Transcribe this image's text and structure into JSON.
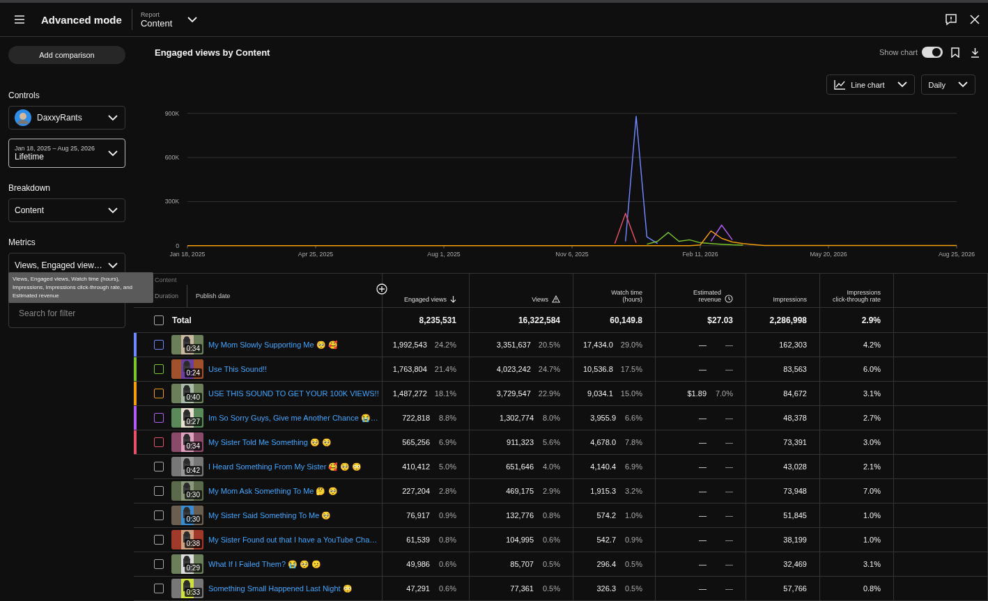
{
  "topbar": {
    "title": "Advanced mode",
    "report_label": "Report",
    "report_value": "Content"
  },
  "sidebar": {
    "add_comparison": "Add comparison",
    "controls_label": "Controls",
    "channel": "DaxxyRants",
    "date_range": "Jan 18, 2025 – Aug 25, 2026",
    "period": "Lifetime",
    "breakdown_label": "Breakdown",
    "breakdown": "Content",
    "metrics_label": "Metrics",
    "metrics": "Views, Engaged view…",
    "tooltip": "Views, Engaged views, Watch time (hours), Impressions, Impressions click-through rate, and Estimated revenue",
    "filter_placeholder": "Search for filter"
  },
  "chart_panel": {
    "title": "Engaged views by Content",
    "show_chart_label": "Show chart",
    "show_chart_on": true,
    "chart_type": "Line chart",
    "interval": "Daily",
    "chart_data": {
      "type": "line",
      "categories": [
        "Jan 18, 2025",
        null,
        null,
        null,
        null,
        null,
        null,
        null,
        null,
        null,
        null,
        null,
        "Apr 25, 2025",
        null,
        null,
        null,
        null,
        null,
        null,
        null,
        null,
        null,
        null,
        null,
        "Aug 1, 2025",
        null,
        null,
        null,
        null,
        null,
        null,
        null,
        null,
        null,
        null,
        null,
        "Nov 6, 2025",
        null,
        null,
        null,
        null,
        null,
        null,
        null,
        null,
        null,
        null,
        null,
        "Feb 11, 2026",
        null,
        null,
        null,
        null,
        null,
        null,
        null,
        null,
        null,
        null,
        null,
        "May 20, 2026",
        null,
        null,
        null,
        null,
        null,
        null,
        null,
        null,
        null,
        null,
        null,
        "Aug 25, 2026"
      ],
      "yticks": [
        {
          "value": 0,
          "label": "0"
        },
        {
          "value": 300000,
          "label": "300K"
        },
        {
          "value": 600000,
          "label": "600K"
        },
        {
          "value": 900000,
          "label": "900K"
        }
      ],
      "ylim": [
        0,
        900000
      ],
      "series": [
        {
          "color": "#6f87ff",
          "values": [
            null,
            null,
            null,
            null,
            null,
            null,
            null,
            null,
            null,
            null,
            null,
            null,
            null,
            null,
            null,
            null,
            null,
            null,
            null,
            null,
            null,
            null,
            null,
            null,
            null,
            null,
            null,
            null,
            null,
            null,
            null,
            null,
            null,
            null,
            null,
            null,
            null,
            null,
            null,
            null,
            null,
            30000,
            880000,
            60000,
            15000,
            null,
            null,
            null,
            null,
            null,
            null,
            null,
            null,
            null,
            null,
            null,
            null,
            null,
            null,
            null,
            null,
            null,
            null,
            null,
            null,
            null,
            null,
            null,
            null,
            null,
            null,
            null,
            null
          ]
        },
        {
          "color": "#7cc62c",
          "values": [
            null,
            null,
            null,
            null,
            null,
            null,
            null,
            null,
            null,
            null,
            null,
            null,
            null,
            null,
            null,
            null,
            null,
            null,
            null,
            null,
            null,
            null,
            null,
            null,
            null,
            null,
            null,
            null,
            null,
            null,
            null,
            null,
            null,
            null,
            null,
            null,
            null,
            null,
            null,
            null,
            null,
            null,
            null,
            10000,
            30000,
            90000,
            30000,
            40000,
            20000,
            15000,
            10000,
            6000,
            4000,
            null,
            null,
            null,
            null,
            null,
            null,
            null,
            null,
            null,
            null,
            null,
            null,
            null,
            null,
            null,
            null,
            null,
            null,
            null,
            null
          ]
        },
        {
          "color": "#b35cf5",
          "values": [
            null,
            null,
            null,
            null,
            null,
            null,
            null,
            null,
            null,
            null,
            null,
            null,
            null,
            null,
            null,
            null,
            null,
            null,
            null,
            null,
            null,
            null,
            null,
            null,
            null,
            null,
            null,
            null,
            null,
            null,
            null,
            null,
            null,
            null,
            null,
            null,
            null,
            null,
            null,
            null,
            null,
            null,
            null,
            null,
            null,
            null,
            null,
            null,
            null,
            30000,
            140000,
            40000,
            null,
            null,
            null,
            null,
            null,
            null,
            null,
            null,
            null,
            null,
            null,
            null,
            null,
            null,
            null,
            null,
            null,
            null,
            null,
            null,
            null
          ]
        },
        {
          "color": "#e9506a",
          "values": [
            null,
            null,
            null,
            null,
            null,
            null,
            null,
            null,
            null,
            null,
            null,
            null,
            null,
            null,
            null,
            null,
            null,
            null,
            null,
            null,
            null,
            null,
            null,
            null,
            null,
            null,
            null,
            null,
            null,
            null,
            null,
            null,
            null,
            null,
            null,
            null,
            null,
            null,
            null,
            null,
            15000,
            220000,
            20000,
            null,
            null,
            null,
            null,
            null,
            null,
            null,
            null,
            null,
            null,
            null,
            null,
            null,
            null,
            null,
            null,
            null,
            null,
            null,
            null,
            null,
            null,
            null,
            null,
            null,
            null,
            null,
            null,
            null,
            null
          ]
        },
        {
          "color": "#f59e0b",
          "values": [
            0,
            0,
            0,
            0,
            0,
            0,
            0,
            0,
            0,
            0,
            0,
            0,
            0,
            0,
            0,
            0,
            0,
            0,
            0,
            0,
            0,
            0,
            0,
            0,
            0,
            0,
            0,
            0,
            0,
            0,
            0,
            0,
            0,
            0,
            0,
            0,
            0,
            0,
            0,
            0,
            0,
            0,
            0,
            0,
            0,
            0,
            0,
            0,
            5000,
            100000,
            50000,
            25000,
            15000,
            8000,
            2000,
            2000,
            2000,
            2000,
            2000,
            2000,
            2000,
            2000,
            2000,
            2000,
            2000,
            2000,
            2000,
            2000,
            2000,
            2000,
            2000,
            2000,
            2000
          ]
        }
      ]
    }
  },
  "table": {
    "headers": {
      "content": "Content",
      "duration": "Duration",
      "publish_date": "Publish date"
    },
    "columns": [
      {
        "label": "Engaged views"
      },
      {
        "label": "Views"
      },
      {
        "label": "Watch time (hours)"
      },
      {
        "label": "Estimated revenue"
      },
      {
        "label": "Impressions"
      },
      {
        "label": "Impressions click-through rate"
      }
    ],
    "total": {
      "label": "Total",
      "checked": false,
      "values": [
        "8,235,531",
        "16,322,584",
        "60,149.8",
        "$27.03",
        "2,286,998",
        "2.9%"
      ]
    },
    "rows": [
      {
        "color": "#6f87ff",
        "checked": false,
        "duration": "0:34",
        "title": "My Mom Slowly Supporting Me 🥺 🥰",
        "cells": [
          {
            "value": "1,992,543",
            "pct": "24.2%"
          },
          {
            "value": "3,351,637",
            "pct": "20.5%"
          },
          {
            "value": "17,434.0",
            "pct": "29.0%"
          },
          {
            "value": "—",
            "pct": "—"
          },
          {
            "value": "162,303"
          },
          {
            "value": "4.2%"
          }
        ]
      },
      {
        "color": "#7cc62c",
        "checked": false,
        "duration": "0:24",
        "title": "Use This Sound!!",
        "cells": [
          {
            "value": "1,763,804",
            "pct": "21.4%"
          },
          {
            "value": "4,023,242",
            "pct": "24.7%"
          },
          {
            "value": "10,536.8",
            "pct": "17.5%"
          },
          {
            "value": "—",
            "pct": "—"
          },
          {
            "value": "83,563"
          },
          {
            "value": "6.0%"
          }
        ]
      },
      {
        "color": "#f59e0b",
        "checked": false,
        "duration": "0:40",
        "title": "USE THIS SOUND TO GET YOUR 100K VIEWS!!",
        "cells": [
          {
            "value": "1,487,272",
            "pct": "18.1%"
          },
          {
            "value": "3,729,547",
            "pct": "22.9%"
          },
          {
            "value": "9,034.1",
            "pct": "15.0%"
          },
          {
            "value": "$1.89",
            "pct": "7.0%"
          },
          {
            "value": "84,672"
          },
          {
            "value": "3.1%"
          }
        ]
      },
      {
        "color": "#b35cf5",
        "checked": false,
        "duration": "0:27",
        "title": "Im So Sorry Guys, Give me Another Chance 😭…",
        "cells": [
          {
            "value": "722,818",
            "pct": "8.8%"
          },
          {
            "value": "1,302,774",
            "pct": "8.0%"
          },
          {
            "value": "3,955.9",
            "pct": "6.6%"
          },
          {
            "value": "—",
            "pct": "—"
          },
          {
            "value": "48,378"
          },
          {
            "value": "2.7%"
          }
        ]
      },
      {
        "color": "#e9506a",
        "checked": false,
        "duration": "0:34",
        "title": "My Sister Told Me Something 🥺 🥺",
        "cells": [
          {
            "value": "565,256",
            "pct": "6.9%"
          },
          {
            "value": "911,323",
            "pct": "5.6%"
          },
          {
            "value": "4,678.0",
            "pct": "7.8%"
          },
          {
            "value": "—",
            "pct": "—"
          },
          {
            "value": "73,391"
          },
          {
            "value": "3.0%"
          }
        ]
      },
      {
        "checked": false,
        "duration": "0:42",
        "title": "I Heard Something From My Sister 🥰 🥺 😳",
        "cells": [
          {
            "value": "410,412",
            "pct": "5.0%"
          },
          {
            "value": "651,646",
            "pct": "4.0%"
          },
          {
            "value": "4,140.4",
            "pct": "6.9%"
          },
          {
            "value": "—",
            "pct": "—"
          },
          {
            "value": "43,028"
          },
          {
            "value": "2.1%"
          }
        ]
      },
      {
        "checked": false,
        "duration": "0:30",
        "title": "My Mom Ask Something To Me 🤔 🥺",
        "cells": [
          {
            "value": "227,204",
            "pct": "2.8%"
          },
          {
            "value": "469,175",
            "pct": "2.9%"
          },
          {
            "value": "1,915.3",
            "pct": "3.2%"
          },
          {
            "value": "—",
            "pct": "—"
          },
          {
            "value": "73,948"
          },
          {
            "value": "7.0%"
          }
        ]
      },
      {
        "checked": false,
        "duration": "0:30",
        "title": "My Sister Said Something To Me 🥺",
        "cells": [
          {
            "value": "76,917",
            "pct": "0.9%"
          },
          {
            "value": "132,776",
            "pct": "0.8%"
          },
          {
            "value": "574.2",
            "pct": "1.0%"
          },
          {
            "value": "—",
            "pct": "—"
          },
          {
            "value": "51,845"
          },
          {
            "value": "1.0%"
          }
        ]
      },
      {
        "checked": false,
        "duration": "0:38",
        "title": "My Sister Found out that I have a YouTube Cha…",
        "cells": [
          {
            "value": "61,539",
            "pct": "0.8%"
          },
          {
            "value": "104,995",
            "pct": "0.6%"
          },
          {
            "value": "542.7",
            "pct": "0.9%"
          },
          {
            "value": "—",
            "pct": "—"
          },
          {
            "value": "38,199"
          },
          {
            "value": "1.0%"
          }
        ]
      },
      {
        "checked": false,
        "duration": "0:29",
        "title": "What If I Failed Them? 😭 🥺 🫤",
        "cells": [
          {
            "value": "49,986",
            "pct": "0.6%"
          },
          {
            "value": "85,707",
            "pct": "0.5%"
          },
          {
            "value": "296.4",
            "pct": "0.5%"
          },
          {
            "value": "—",
            "pct": "—"
          },
          {
            "value": "32,469"
          },
          {
            "value": "3.1%"
          }
        ]
      },
      {
        "checked": false,
        "duration": "0:33",
        "title": "Something Small Happened Last Night 😳",
        "cells": [
          {
            "value": "47,291",
            "pct": "0.6%"
          },
          {
            "value": "77,361",
            "pct": "0.5%"
          },
          {
            "value": "326.3",
            "pct": "0.5%"
          },
          {
            "value": "—",
            "pct": "—"
          },
          {
            "value": "57,766"
          },
          {
            "value": "0.8%"
          }
        ]
      }
    ]
  }
}
